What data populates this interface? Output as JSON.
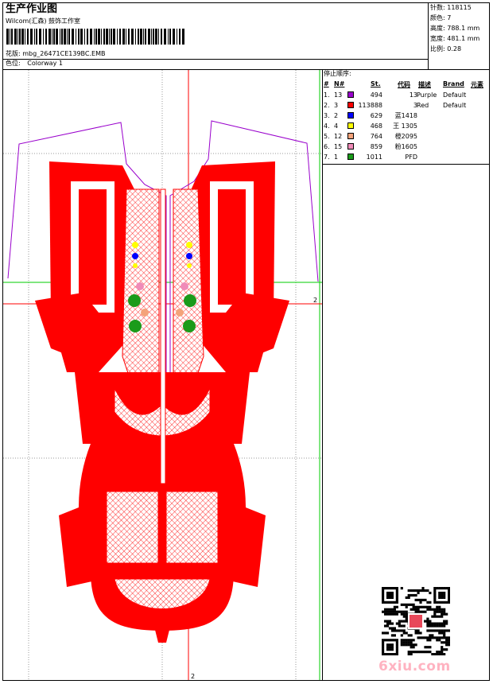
{
  "header": {
    "title": "生产作业图",
    "studio": "Wilcom(汇森) 鼓饰工作室",
    "design_label": "花版:",
    "design_file": "mbg_26471CE139BC.EMB",
    "colorway_label": "色位:",
    "colorway": "Colorway 1"
  },
  "stats": [
    {
      "label": "针数:",
      "value": "118115"
    },
    {
      "label": "颜色:",
      "value": "7"
    },
    {
      "label": "高度:",
      "value": "788.1 mm"
    },
    {
      "label": "宽度:",
      "value": "481.1 mm"
    },
    {
      "label": "比例:",
      "value": "0.28"
    }
  ],
  "stop_sequence": {
    "title": "停止顺序:",
    "columns": [
      "#",
      "N#",
      "St.",
      "代码",
      "描述",
      "Brand",
      "元素"
    ],
    "rows": [
      {
        "num": "1.",
        "needle": "13",
        "color": "#9900cc",
        "stitches": "494",
        "code": "13",
        "desc": "Purple",
        "brand": "Default"
      },
      {
        "num": "2.",
        "needle": "3",
        "color": "#ff0000",
        "stitches": "113888",
        "code": "3",
        "desc": "Red",
        "brand": "Default"
      },
      {
        "num": "3.",
        "needle": "2",
        "color": "#0000ff",
        "stitches": "629",
        "code": "蓝1418",
        "desc": "",
        "brand": ""
      },
      {
        "num": "4.",
        "needle": "4",
        "color": "#ffff00",
        "stitches": "468",
        "code": "王 1305",
        "desc": "",
        "brand": ""
      },
      {
        "num": "5.",
        "needle": "12",
        "color": "#f4a37a",
        "stitches": "764",
        "code": "橙2095",
        "desc": "",
        "brand": ""
      },
      {
        "num": "6.",
        "needle": "15",
        "color": "#f08bb8",
        "stitches": "859",
        "code": "粉1605",
        "desc": "",
        "brand": ""
      },
      {
        "num": "7.",
        "needle": "1",
        "color": "#1a9b1a",
        "stitches": "1011",
        "code": "PFD",
        "desc": "",
        "brand": ""
      }
    ]
  },
  "canvas": {
    "marker_h": "2",
    "marker_v": "2",
    "guide_red": "#ff0000",
    "guide_green": "#00cc00",
    "outline": "#9900cc",
    "fill": "#ff0000"
  },
  "watermark": "6xiu.com",
  "icons": [
    "barcode-icon",
    "qr-code-icon"
  ]
}
